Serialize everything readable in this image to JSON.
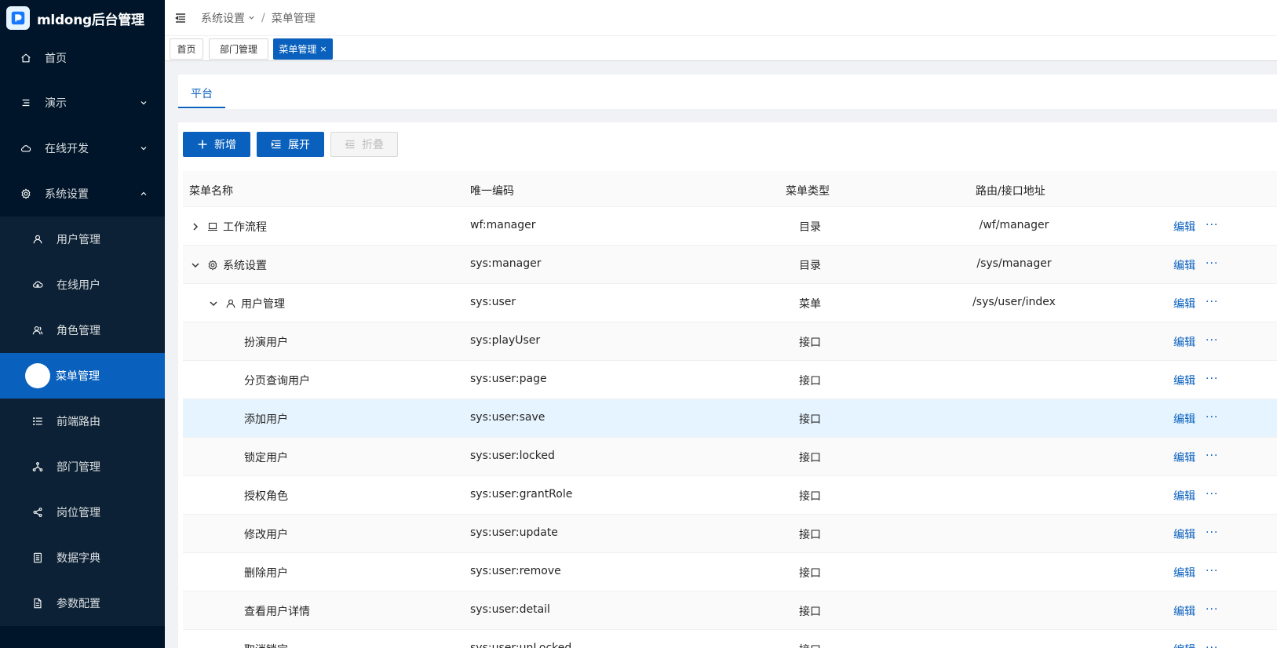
{
  "app": {
    "title": "mldong后台管理"
  },
  "sidebar": {
    "items": [
      {
        "label": "首页",
        "icon": "home-icon"
      },
      {
        "label": "演示",
        "icon": "list-icon",
        "expandable": true
      },
      {
        "label": "在线开发",
        "icon": "cloud-icon",
        "expandable": true
      },
      {
        "label": "系统设置",
        "icon": "gear-icon",
        "expandable": true,
        "expanded": true
      }
    ],
    "sub_items": [
      {
        "label": "用户管理",
        "icon": "user-icon"
      },
      {
        "label": "在线用户",
        "icon": "online-icon"
      },
      {
        "label": "角色管理",
        "icon": "role-icon"
      },
      {
        "label": "菜单管理",
        "icon": "menu-icon",
        "active": true
      },
      {
        "label": "前端路由",
        "icon": "route-icon"
      },
      {
        "label": "部门管理",
        "icon": "dept-icon"
      },
      {
        "label": "岗位管理",
        "icon": "share-icon"
      },
      {
        "label": "数据字典",
        "icon": "dict-icon"
      },
      {
        "label": "参数配置",
        "icon": "file-icon"
      }
    ]
  },
  "header": {
    "breadcrumb": [
      "系统设置",
      "菜单管理"
    ],
    "separator": "/"
  },
  "tabs": [
    {
      "label": "首页"
    },
    {
      "label": "部门管理"
    },
    {
      "label": "菜单管理",
      "active": true,
      "close": "×"
    }
  ],
  "platform_tab": {
    "label": "平台"
  },
  "toolbar": {
    "add_label": "新增",
    "expand_label": "展开",
    "collapse_label": "折叠"
  },
  "table": {
    "columns": [
      "菜单名称",
      "唯一编码",
      "菜单类型",
      "路由/接口地址"
    ],
    "edit_label": "编辑",
    "more_label": "···",
    "rows": [
      {
        "name": "工作流程",
        "code": "wf:manager",
        "type": "目录",
        "path": "/wf/manager"
      },
      {
        "name": "系统设置",
        "code": "sys:manager",
        "type": "目录",
        "path": "/sys/manager"
      },
      {
        "name": "用户管理",
        "code": "sys:user",
        "type": "菜单",
        "path": "/sys/user/index"
      },
      {
        "name": "扮演用户",
        "code": "sys:playUser",
        "type": "接口",
        "path": ""
      },
      {
        "name": "分页查询用户",
        "code": "sys:user:page",
        "type": "接口",
        "path": ""
      },
      {
        "name": "添加用户",
        "code": "sys:user:save",
        "type": "接口",
        "path": ""
      },
      {
        "name": "锁定用户",
        "code": "sys:user:locked",
        "type": "接口",
        "path": ""
      },
      {
        "name": "授权角色",
        "code": "sys:user:grantRole",
        "type": "接口",
        "path": ""
      },
      {
        "name": "修改用户",
        "code": "sys:user:update",
        "type": "接口",
        "path": ""
      },
      {
        "name": "删除用户",
        "code": "sys:user:remove",
        "type": "接口",
        "path": ""
      },
      {
        "name": "查看用户详情",
        "code": "sys:user:detail",
        "type": "接口",
        "path": ""
      },
      {
        "name": "取消锁定",
        "code": "sys:user:unLocked",
        "type": "接口",
        "path": ""
      }
    ]
  },
  "colors": {
    "primary": "#0960bd",
    "sidebar_bg": "#001529",
    "submenu_bg": "#0c2135",
    "hover_row": "#e6f4ff"
  }
}
